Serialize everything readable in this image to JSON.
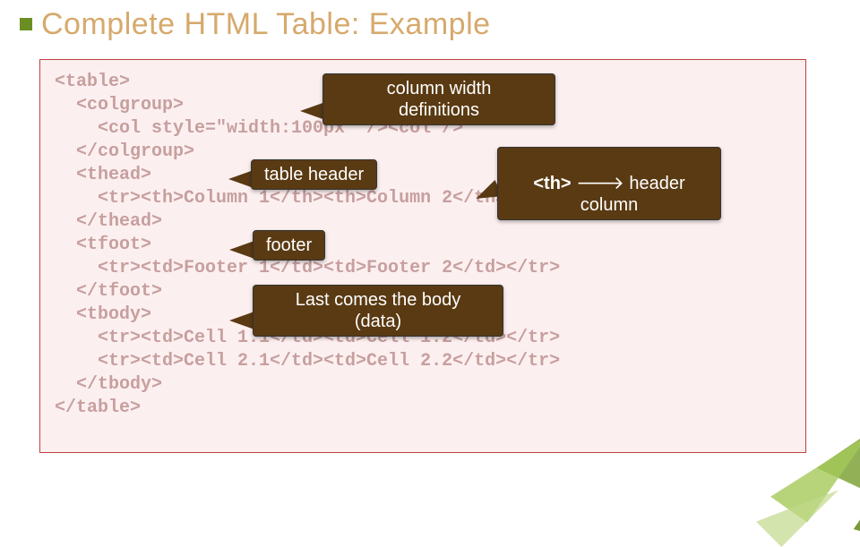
{
  "title": "Complete HTML Table: Example",
  "code_lines": [
    "<table>",
    "  <colgroup>",
    "    <col style=\"width:100px\" /><col />",
    "  </colgroup>",
    "  <thead>",
    "    <tr><th>Column 1</th><th>Column 2</th></tr>",
    "  </thead>",
    "  <tfoot>",
    "    <tr><td>Footer 1</td><td>Footer 2</td></tr>",
    "  </tfoot>",
    "  <tbody>",
    "    <tr><td>Cell 1.1</td><td>Cell 1.2</td></tr>",
    "    <tr><td>Cell 2.1</td><td>Cell 2.2</td></tr>",
    "  </tbody>",
    "</table>"
  ],
  "callouts": {
    "colwidth": "column width\ndefinitions",
    "tableheader": "table header",
    "th_prefix": "<th>",
    "th_rest": " 🡒 header\ncolumn",
    "footer": "footer",
    "body": "Last comes the body\n(data)"
  }
}
